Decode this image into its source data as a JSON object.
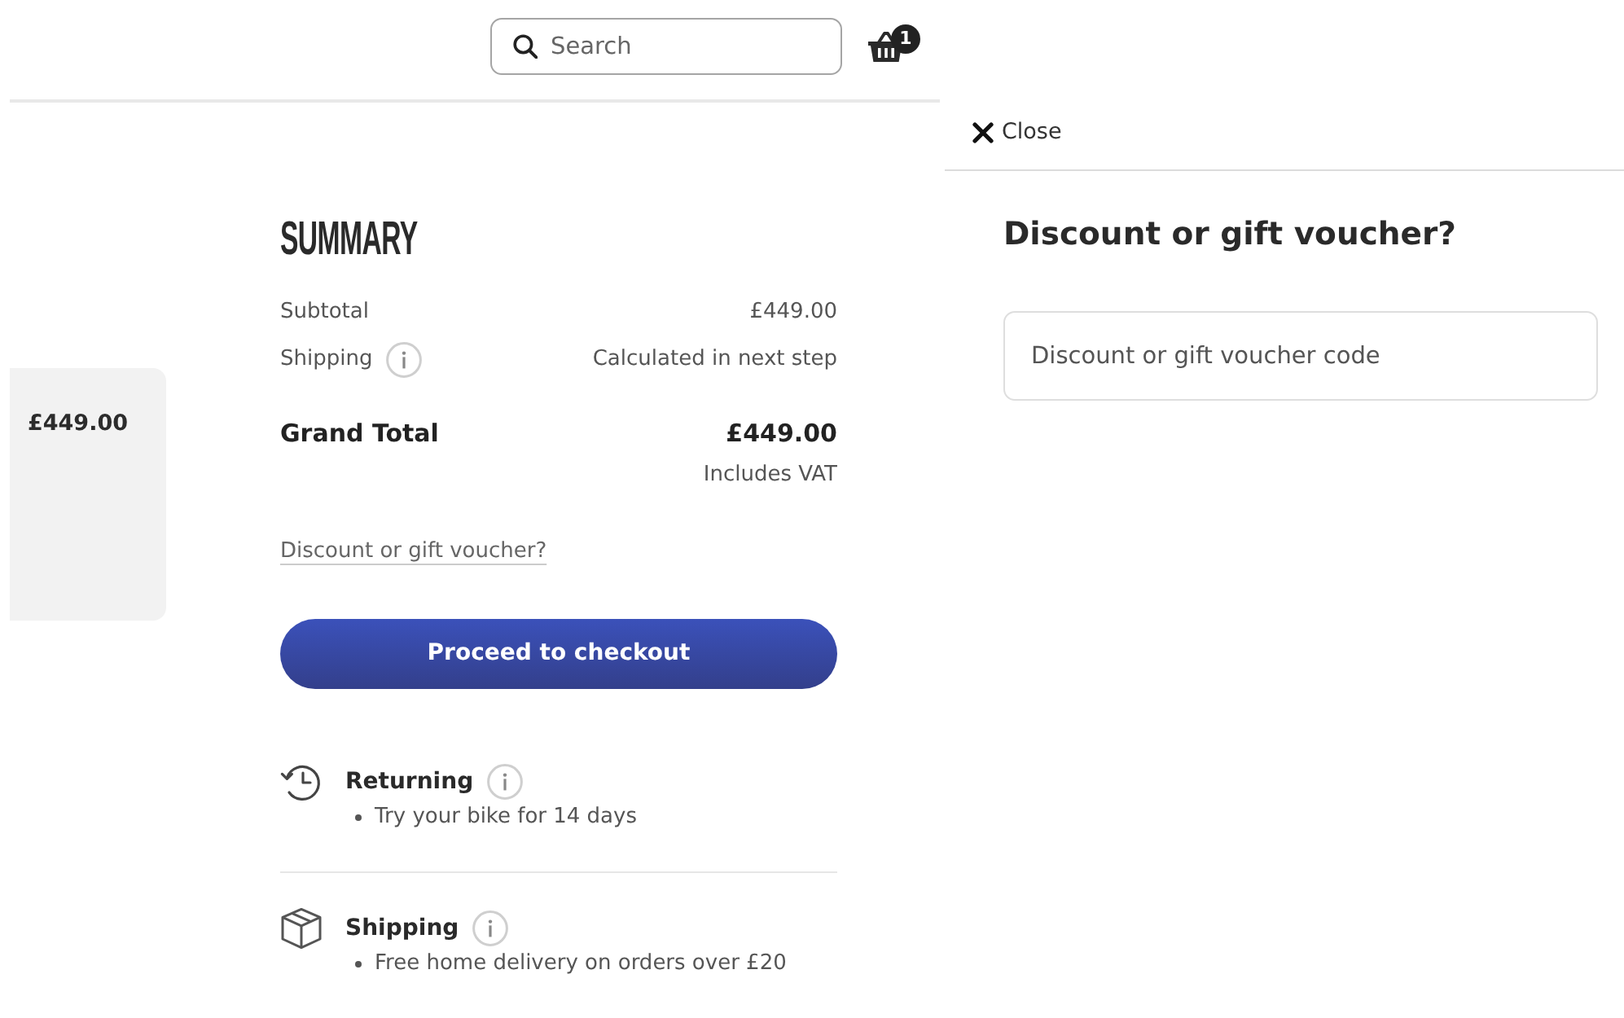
{
  "header": {
    "search": {
      "placeholder": "Search"
    },
    "basket": {
      "count": "1"
    }
  },
  "product_card": {
    "price": "£449.00"
  },
  "summary": {
    "title": "SUMMARY",
    "rows": [
      {
        "label": "Subtotal",
        "value": "£449.00",
        "info": false
      },
      {
        "label": "Shipping",
        "value": "Calculated in next step",
        "info": true
      }
    ],
    "grand_total": {
      "label": "Grand Total",
      "value": "£449.00",
      "note": "Includes VAT"
    },
    "voucher_link": "Discount or gift voucher?",
    "checkout_button": "Proceed to checkout"
  },
  "benefits": [
    {
      "kind": "returning",
      "title": "Returning",
      "points": [
        "Try your bike for 14 days"
      ]
    },
    {
      "kind": "shipping",
      "title": "Shipping",
      "points": [
        "Free home delivery on orders over £20"
      ]
    }
  ],
  "drawer": {
    "close": "Close",
    "title": "Discount or gift voucher?",
    "voucher_field": {
      "placeholder": "Discount or gift voucher code"
    }
  }
}
